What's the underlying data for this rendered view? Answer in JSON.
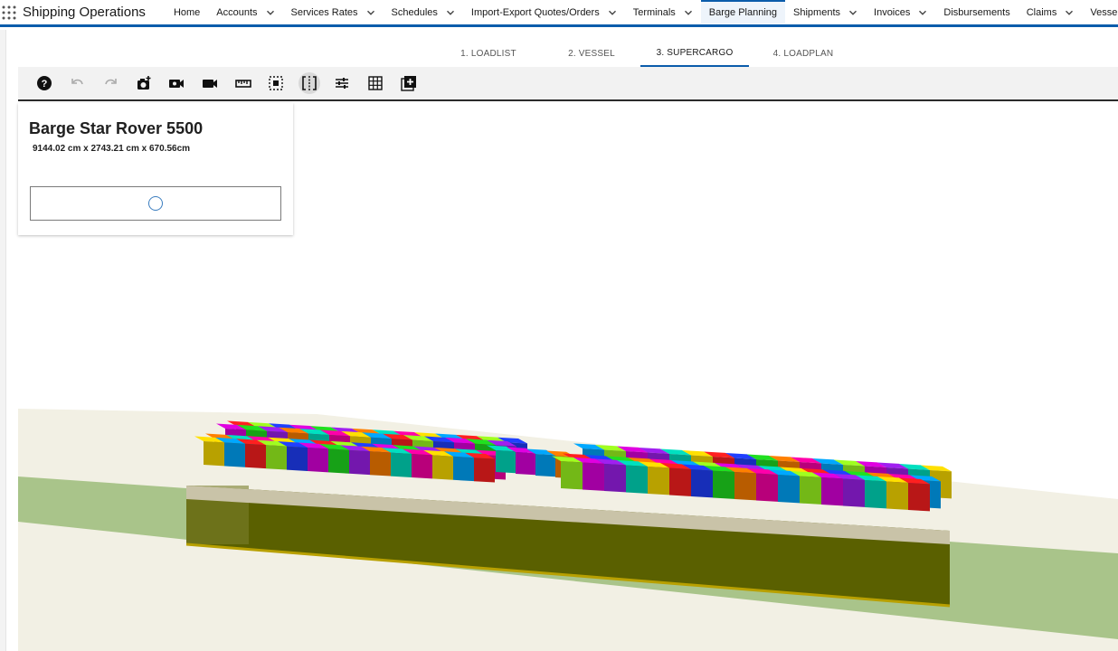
{
  "app": {
    "name": "Shipping Operations"
  },
  "nav": {
    "items": [
      {
        "label": "Home",
        "dropdown": false
      },
      {
        "label": "Accounts",
        "dropdown": true
      },
      {
        "label": "Services Rates",
        "dropdown": true
      },
      {
        "label": "Schedules",
        "dropdown": true
      },
      {
        "label": "Import-Export Quotes/Orders",
        "dropdown": true
      },
      {
        "label": "Terminals",
        "dropdown": true
      },
      {
        "label": "Barge Planning",
        "dropdown": false,
        "active": true
      },
      {
        "label": "Shipments",
        "dropdown": true
      },
      {
        "label": "Invoices",
        "dropdown": true
      },
      {
        "label": "Disbursements",
        "dropdown": false
      },
      {
        "label": "Claims",
        "dropdown": true
      },
      {
        "label": "Vessels",
        "dropdown": true
      }
    ]
  },
  "steps": [
    {
      "label": "1. LOADLIST"
    },
    {
      "label": "2. VESSEL"
    },
    {
      "label": "3. SUPERCARGO",
      "active": true
    },
    {
      "label": "4. LOADPLAN"
    }
  ],
  "toolbar": {
    "tools": [
      "help-icon",
      "undo-icon",
      "redo-icon",
      "camera-add-icon",
      "video-camera-icon",
      "video-record-icon",
      "ruler-icon",
      "select-box-icon",
      "split-view-icon",
      "sliders-icon",
      "grid-icon",
      "add-box-icon"
    ],
    "selected": "split-view-icon"
  },
  "card": {
    "title": "Barge Star Rover 5500",
    "dimensions": "9144.02 cm x 2743.21 cm x 670.56cm"
  },
  "colors": {
    "accent": "#0b5cab",
    "hull": "#5a6000",
    "water": "#a9c48a",
    "container_palette": [
      "#ff2020",
      "#ff00aa",
      "#a020f0",
      "#2040ff",
      "#00a8ff",
      "#00e0c0",
      "#20e020",
      "#a0ff20",
      "#ffe000",
      "#ff8000",
      "#e000e0"
    ]
  }
}
